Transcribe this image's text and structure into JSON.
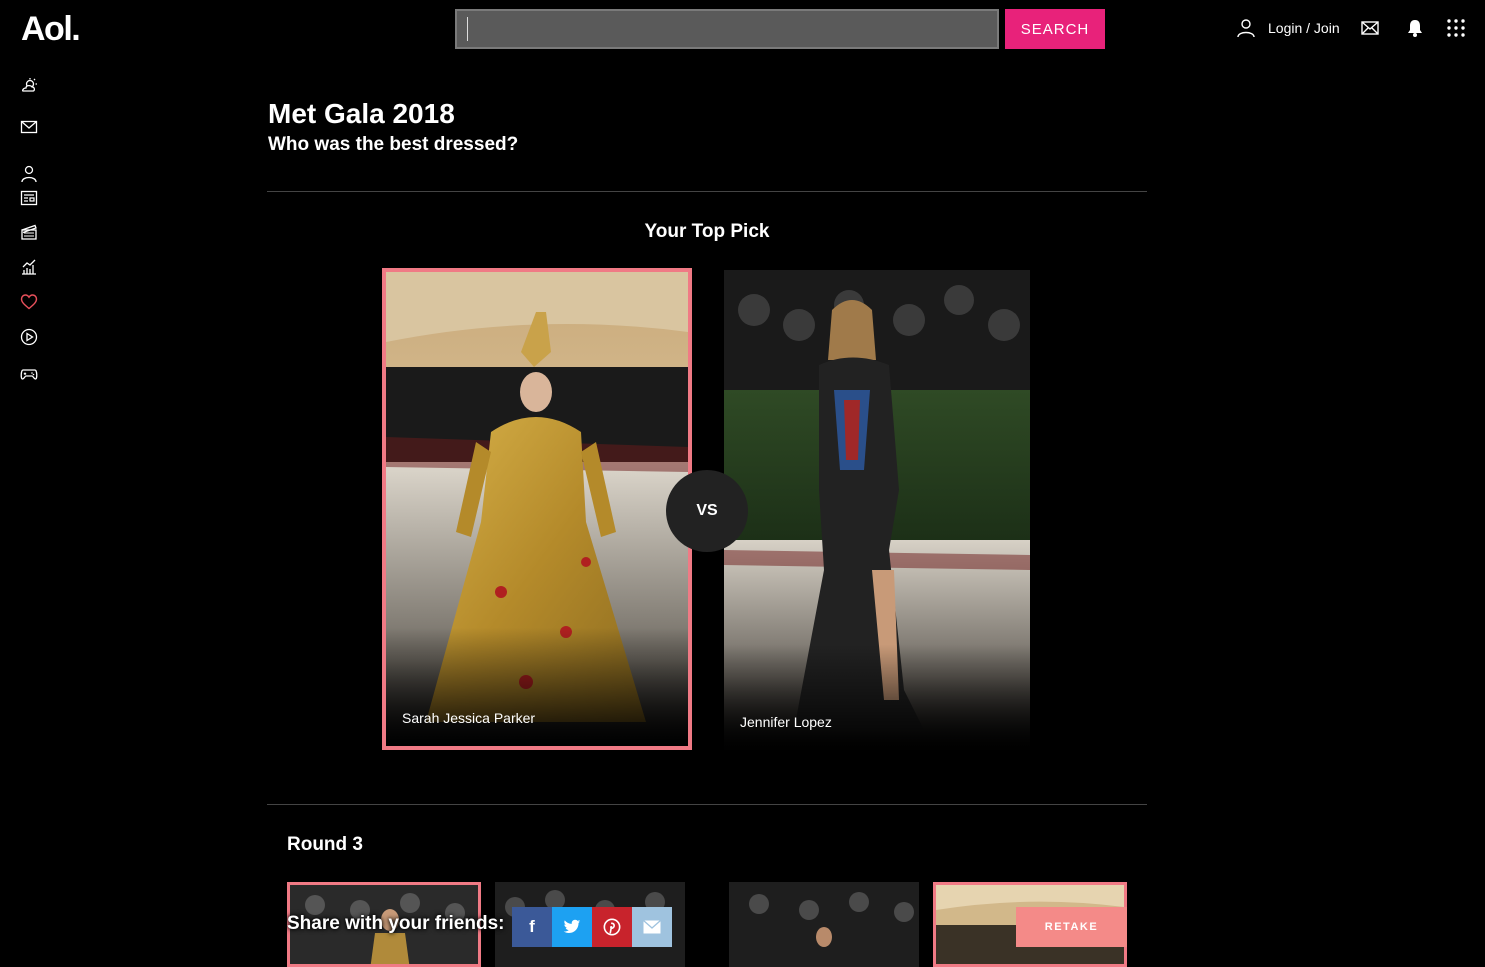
{
  "header": {
    "logo": "Aol.",
    "search_placeholder": "",
    "search_button": "SEARCH",
    "login_label": "Login / Join"
  },
  "sidebar": {
    "icons": [
      "weather-icon",
      "mail-icon",
      "user-icon",
      "news-icon",
      "entertainment-icon",
      "finance-icon",
      "lifestyle-icon",
      "video-icon",
      "games-icon"
    ],
    "active_color": "#e8505b"
  },
  "quiz": {
    "title": "Met Gala 2018",
    "subtitle": "Who was the best dressed?",
    "section_title": "Your Top Pick",
    "vs_label": "VS",
    "left_pick": {
      "name": "Sarah Jessica Parker",
      "selected": true
    },
    "right_pick": {
      "name": "Jennifer Lopez",
      "selected": false
    },
    "round_label": "Round 3"
  },
  "share": {
    "label": "Share with your friends:",
    "buttons": [
      "f",
      "t",
      "p",
      "✉"
    ],
    "retake_label": "RETAKE"
  },
  "colors": {
    "accent": "#e8227a",
    "selected_border": "#f07a85",
    "facebook": "#3b5998",
    "twitter": "#1da1f2",
    "pinterest": "#c8232c",
    "email": "#9fc3df",
    "retake": "#f48a88"
  }
}
